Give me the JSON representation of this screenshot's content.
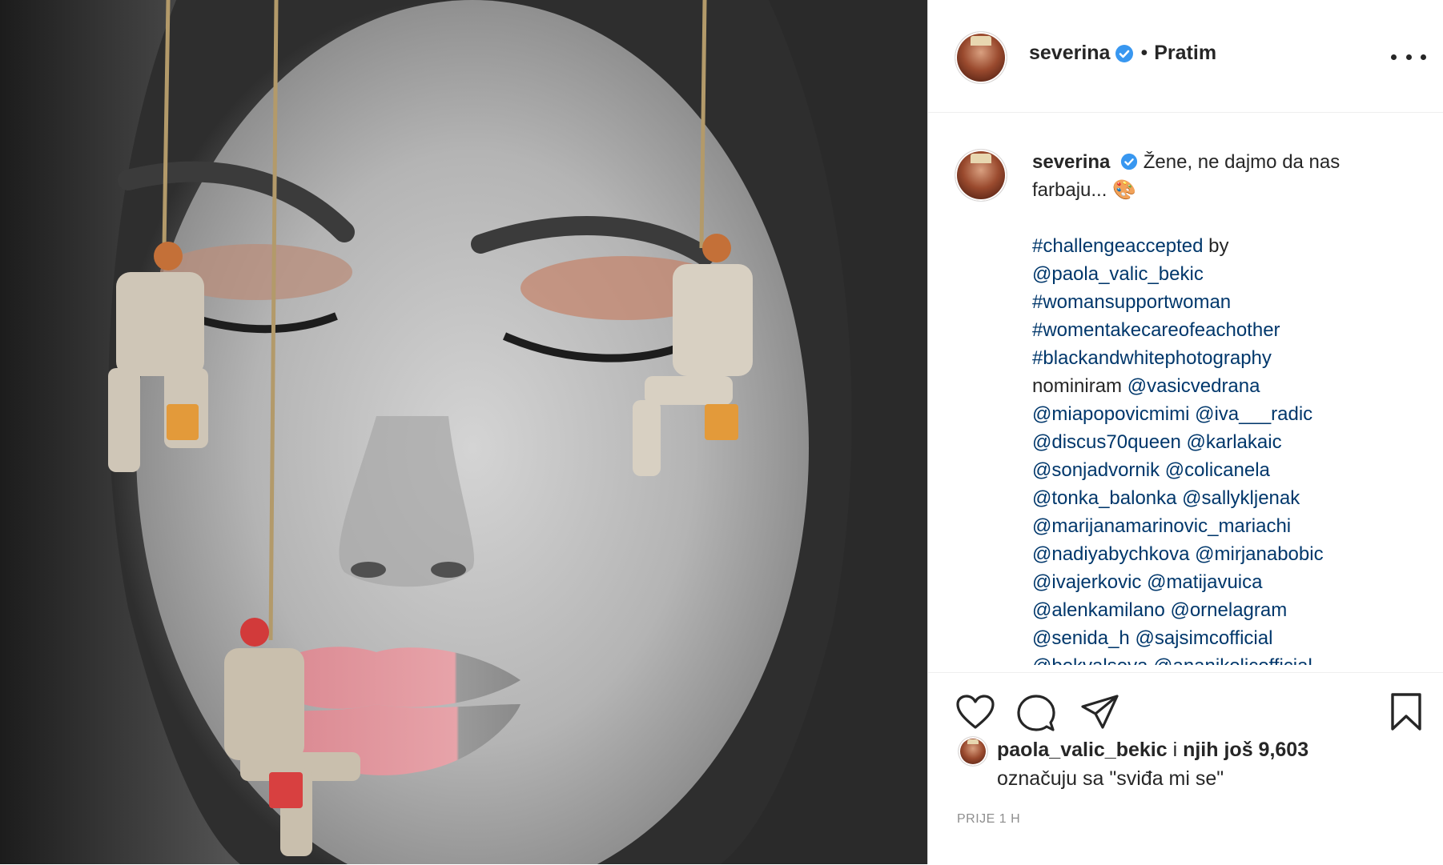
{
  "post": {
    "username": "severina",
    "follow_dot": "•",
    "follow_label": "Pratim",
    "more_label": "More options"
  },
  "caption": {
    "username": "severina",
    "intro": "Žene, ne dajmo da nas farbaju... 🎨",
    "lines": [
      {
        "parts": [
          {
            "t": "#challengeaccepted",
            "tag": true
          },
          {
            "t": " by",
            "tag": false
          }
        ]
      },
      {
        "parts": [
          {
            "t": "@paola_valic_bekic",
            "tag": true
          }
        ]
      },
      {
        "parts": [
          {
            "t": "#womansupportwoman",
            "tag": true
          }
        ]
      },
      {
        "parts": [
          {
            "t": "#womentakecareofeachother",
            "tag": true
          }
        ]
      },
      {
        "parts": [
          {
            "t": "#blackandwhitephotography",
            "tag": true
          }
        ]
      },
      {
        "parts": [
          {
            "t": "nominiram ",
            "tag": false
          },
          {
            "t": "@vasicvedrana",
            "tag": true
          }
        ]
      },
      {
        "parts": [
          {
            "t": "@miapopovicmimi",
            "tag": true
          },
          {
            "t": " ",
            "tag": false
          },
          {
            "t": "@iva___radic",
            "tag": true
          }
        ]
      },
      {
        "parts": [
          {
            "t": "@discus70queen",
            "tag": true
          },
          {
            "t": " ",
            "tag": false
          },
          {
            "t": "@karlakaic",
            "tag": true
          }
        ]
      },
      {
        "parts": [
          {
            "t": "@sonjadvornik",
            "tag": true
          },
          {
            "t": " ",
            "tag": false
          },
          {
            "t": "@colicanela",
            "tag": true
          }
        ]
      },
      {
        "parts": [
          {
            "t": "@tonka_balonka",
            "tag": true
          },
          {
            "t": " ",
            "tag": false
          },
          {
            "t": "@sallykljenak",
            "tag": true
          }
        ]
      },
      {
        "parts": [
          {
            "t": "@marijanamarinovic_mariachi",
            "tag": true
          }
        ]
      },
      {
        "parts": [
          {
            "t": "@nadiyabychkova",
            "tag": true
          },
          {
            "t": " ",
            "tag": false
          },
          {
            "t": "@mirjanabobic",
            "tag": true
          }
        ]
      },
      {
        "parts": [
          {
            "t": "@ivajerkovic",
            "tag": true
          },
          {
            "t": " ",
            "tag": false
          },
          {
            "t": "@matijavuica",
            "tag": true
          }
        ]
      },
      {
        "parts": [
          {
            "t": "@alenkamilano",
            "tag": true
          },
          {
            "t": " ",
            "tag": false
          },
          {
            "t": "@ornelagram",
            "tag": true
          }
        ]
      },
      {
        "parts": [
          {
            "t": "@senida_h",
            "tag": true
          },
          {
            "t": " ",
            "tag": false
          },
          {
            "t": "@sajsimcofficial",
            "tag": true
          }
        ]
      },
      {
        "parts": [
          {
            "t": "@bekvalseva",
            "tag": true
          },
          {
            "t": " ",
            "tag": false
          },
          {
            "t": "@ananikolicofficial",
            "tag": true
          }
        ]
      }
    ]
  },
  "likes": {
    "liker": "paola_valic_bekic",
    "connector": " i ",
    "others": "njih još 9,603",
    "suffix": "označuju sa \"sviđa mi se\""
  },
  "timestamp": "PRIJE 1 H",
  "icons": {
    "like": "heart-icon",
    "comment": "comment-icon",
    "share": "paper-plane-icon",
    "save": "bookmark-icon",
    "verified": "verified-badge-icon",
    "more": "more-horizontal-icon"
  },
  "colors": {
    "link": "#00376b",
    "text": "#262626",
    "muted": "#8e8e8e",
    "verified": "#3897f0"
  }
}
